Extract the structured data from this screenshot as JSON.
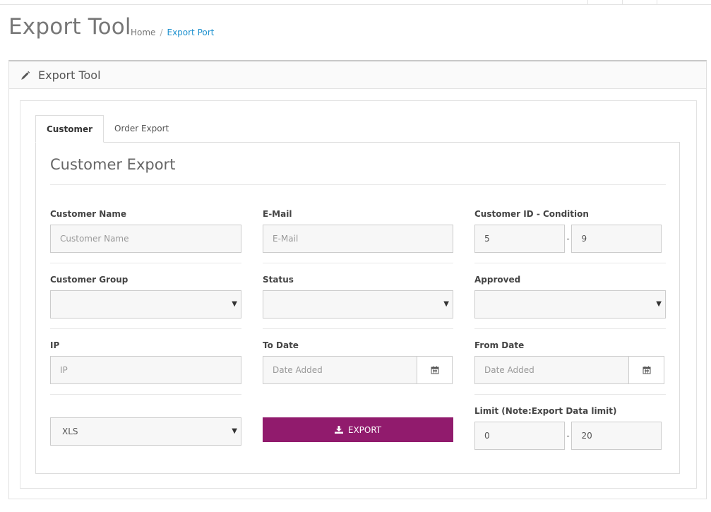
{
  "page": {
    "title": "Export Tool",
    "breadcrumb": [
      {
        "label": "Home"
      },
      {
        "label": "Export Port"
      }
    ],
    "breadcrumb_separator": "/"
  },
  "panel": {
    "heading": "Export Tool",
    "heading_icon": "pencil-icon"
  },
  "tabs": [
    {
      "label": "Customer",
      "active": true
    },
    {
      "label": "Order Export",
      "active": false
    }
  ],
  "customer_export": {
    "title": "Customer Export",
    "customer_name": {
      "label": "Customer Name",
      "placeholder": "Customer Name",
      "value": ""
    },
    "email": {
      "label": "E-Mail",
      "placeholder": "E-Mail",
      "value": ""
    },
    "customer_id_condition": {
      "label": "Customer ID - Condition",
      "from": "5",
      "to": "9",
      "separator": "-"
    },
    "customer_group": {
      "label": "Customer Group",
      "selected": ""
    },
    "status": {
      "label": "Status",
      "selected": ""
    },
    "approved": {
      "label": "Approved",
      "selected": ""
    },
    "ip": {
      "label": "IP",
      "placeholder": "IP",
      "value": ""
    },
    "to_date": {
      "label": "To Date",
      "placeholder": "Date Added",
      "icon": "calendar-icon"
    },
    "from_date": {
      "label": "From Date",
      "placeholder": "Date Added",
      "icon": "calendar-icon"
    },
    "format_select": {
      "selected": "XLS"
    },
    "export_button": {
      "label": "EXPORT",
      "icon": "download-icon",
      "color": "#911b6d"
    },
    "limit": {
      "label": "Limit (Note:Export Data limit)",
      "from": "0",
      "to": "20",
      "separator": "-"
    }
  },
  "colors": {
    "accent": "#911b6d",
    "link": "#1e91cf"
  }
}
